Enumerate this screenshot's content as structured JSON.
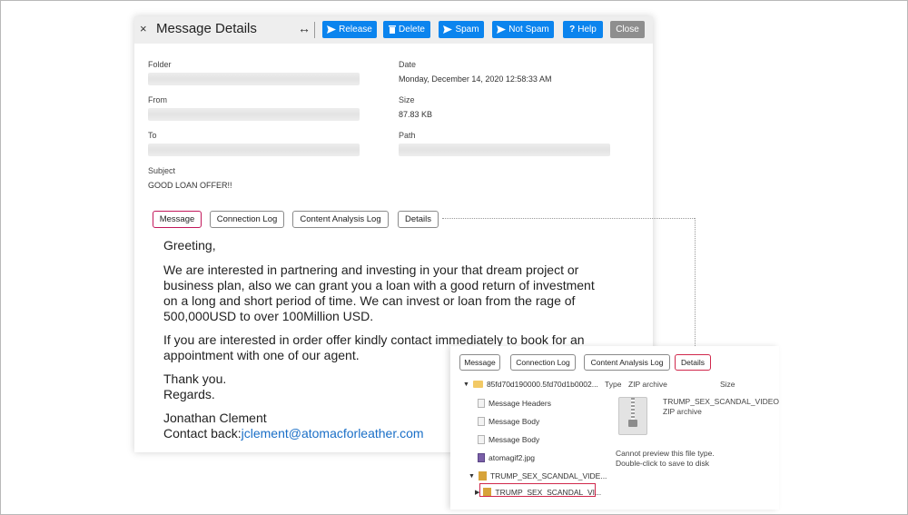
{
  "header": {
    "close_glyph": "×",
    "title": "Message Details",
    "expand_glyph": "↔",
    "buttons": [
      {
        "label": "Release",
        "icon": "send-icon"
      },
      {
        "label": "Delete",
        "icon": "trash-icon"
      },
      {
        "label": "Spam",
        "icon": "send-icon"
      },
      {
        "label": "Not Spam",
        "icon": "send-icon"
      },
      {
        "label": "Help",
        "icon": "question-icon"
      },
      {
        "label": "Close"
      }
    ],
    "button_color": "#0b84ee",
    "close_color": "#8e8e8e"
  },
  "fields": {
    "folder_label": "Folder",
    "date_label": "Date",
    "date_value": "Monday, December 14, 2020 12:58:33 AM",
    "from_label": "From",
    "size_label": "Size",
    "size_value": "87.83 KB",
    "to_label": "To",
    "path_label": "Path",
    "subject_label": "Subject",
    "subject_value": "GOOD LOAN OFFER!!"
  },
  "tabs": [
    "Message",
    "Connection Log",
    "Content Analysis Log",
    "Details"
  ],
  "message": {
    "greeting": "Greeting,",
    "p1": [
      "We are interested in partnering and investing in your that dream project or",
      "business plan, also we can grant you a loan with a good return of investment",
      "on a long and short period of time. We can invest or loan from the rage of",
      "500,000USD to over 100Million USD."
    ],
    "p2": [
      "If you are interested in order offer kindly contact immediately to book for an",
      "appointment with one of our agent."
    ],
    "thanks": "Thank you.",
    "regards": "Regards.",
    "name": "Jonathan Clement",
    "contact_prefix": "Contact back:",
    "contact_email": "jclement@atomacforleather.com"
  },
  "overlay": {
    "tabs": [
      "Message",
      "Connection Log",
      "Content Analysis Log",
      "Details"
    ],
    "active_tab": "Details",
    "tree": {
      "root": "85fd70d190000.5fd70d1b0002...",
      "message_headers": "Message Headers",
      "message_body_1": "Message Body",
      "message_body_2": "Message Body",
      "image": "atomagif2.jpg",
      "zip_parent": "TRUMP_SEX_SCANDAL_VIDE...",
      "zip_child": "TRUMP_SEX_SCANDAL_VI..."
    },
    "type_label": "Type",
    "type_value": "ZIP archive",
    "size_label": "Size",
    "file_name": "TRUMP_SEX_SCANDAL_VIDEO.jar",
    "file_type": "ZIP archive",
    "preview_line1": "Cannot preview this file type.",
    "preview_line2": "Double-click to save to disk"
  },
  "colors": {
    "highlight": "#c2185b",
    "link": "#1a6fc7"
  }
}
